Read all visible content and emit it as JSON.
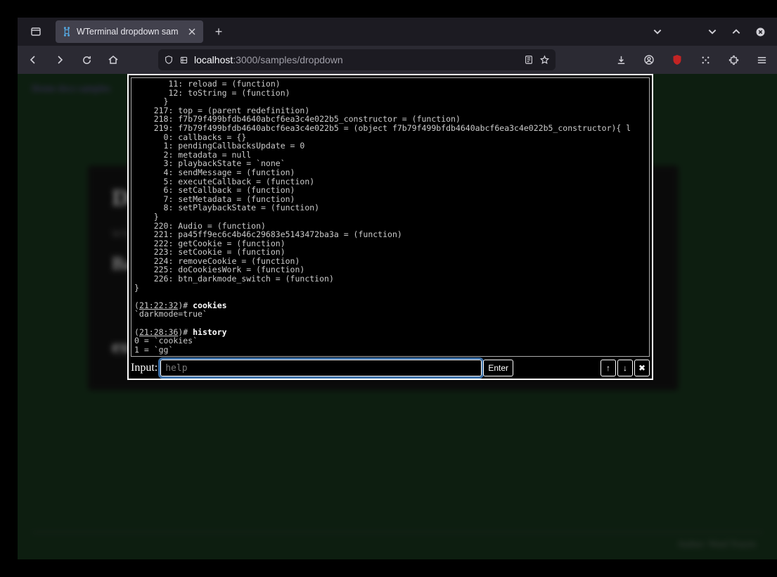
{
  "browser": {
    "tab_title": "WTerminal dropdown sam",
    "url_host": "localhost",
    "url_port_path": ":3000/samples/dropdown"
  },
  "bg_page": {
    "breadcrumb": "Home  docs  samples",
    "title": "Dropdown",
    "subtitle": "WTerminal dropdown sample",
    "section": "Basic",
    "section2_prefix": "ext",
    "footer": "Author: Ward Truyen"
  },
  "terminal": {
    "output_lines_top": [
      "       11: reload = (function)",
      "       12: toString = (function)",
      "      }",
      "    217: top = (parent redefinition)",
      "    218: f7b79f499bfdb4640abcf6ea3c4e022b5_constructor = (function)",
      "    219: f7b79f499bfdb4640abcf6ea3c4e022b5 = (object f7b79f499bfdb4640abcf6ea3c4e022b5_constructor){ l",
      "      0: callbacks = {}",
      "      1: pendingCallbacksUpdate = 0",
      "      2: metadata = null",
      "      3: playbackState = `none`",
      "      4: sendMessage = (function)",
      "      5: executeCallback = (function)",
      "      6: setCallback = (function)",
      "      7: setMetadata = (function)",
      "      8: setPlaybackState = (function)",
      "    }",
      "    220: Audio = (function)",
      "    221: pa45ff9ec6c4b46c29683e5143472ba3a = (function)",
      "    222: getCookie = (function)",
      "    223: setCookie = (function)",
      "    224: removeCookie = (function)",
      "    225: doCookiesWork = (function)",
      "    226: btn_darkmode_switch = (function)",
      "}",
      ""
    ],
    "prompt1_time": "21:22:32",
    "prompt1_cmd": "cookies",
    "prompt1_out": "`darkmode=true`",
    "prompt2_time": "21:28:36",
    "prompt2_cmd": "history",
    "prompt2_out": [
      "0 = `cookies`",
      "1 = `gg`"
    ],
    "input_label": "Input:",
    "input_placeholder": "help",
    "enter_label": "Enter",
    "up_label": "↑",
    "down_label": "↓",
    "close_label": "✖"
  }
}
